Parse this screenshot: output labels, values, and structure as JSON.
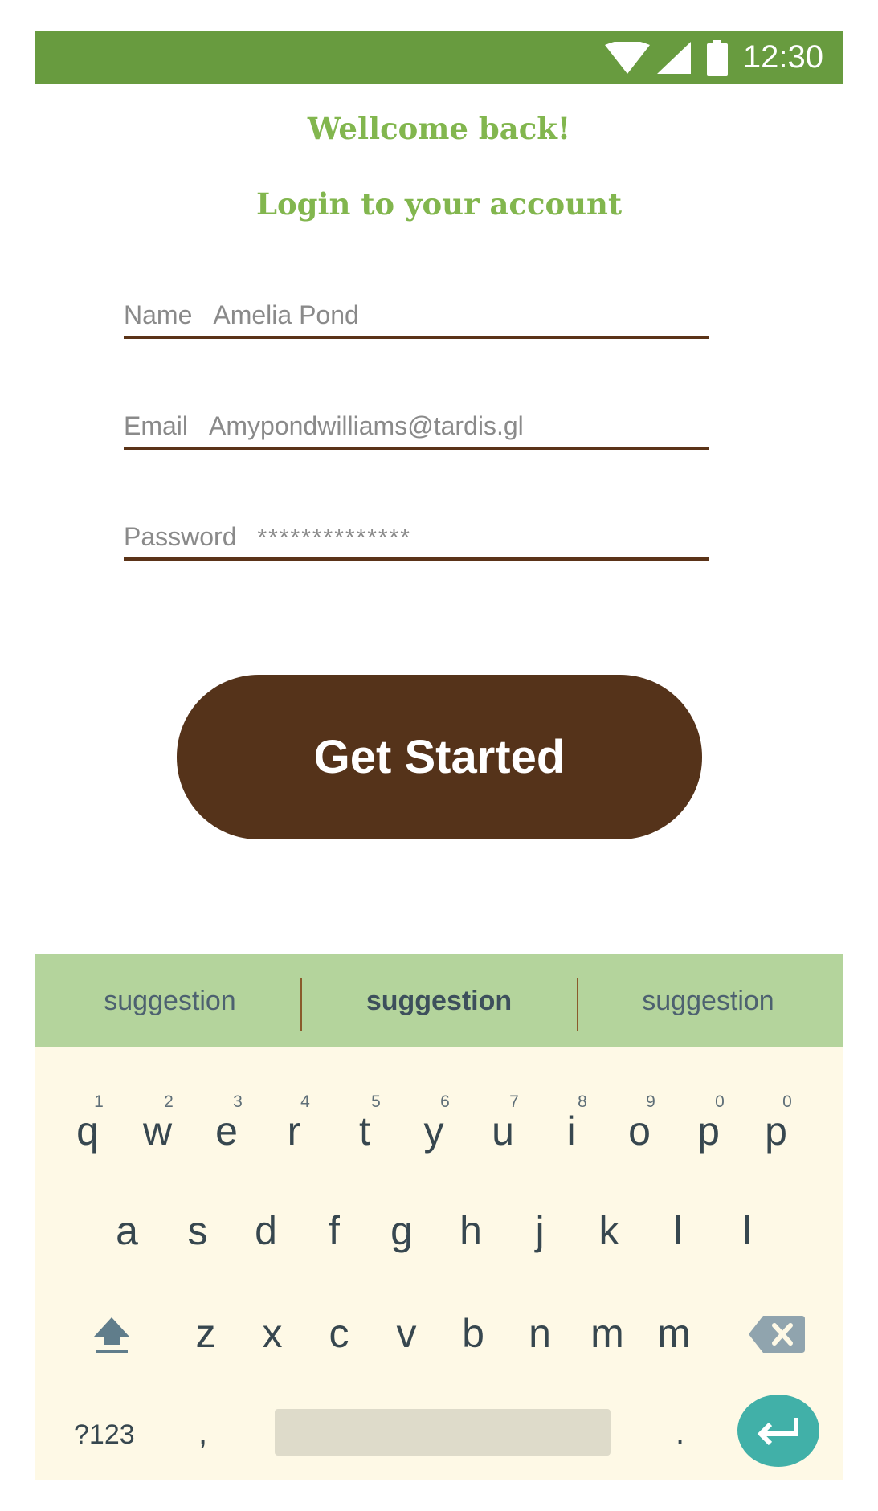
{
  "status_bar": {
    "time": "12:30",
    "icons": [
      "wifi-icon",
      "cell-signal-icon",
      "battery-icon"
    ]
  },
  "header": {
    "welcome": "Wellcome back!",
    "subtitle": "Login to your account"
  },
  "form": {
    "name": {
      "label": "Name",
      "value": "Amelia Pond"
    },
    "email": {
      "label": "Email",
      "value": "Amypondwilliams@tardis.gl"
    },
    "password": {
      "label": "Password",
      "value": "**************"
    },
    "submit_label": "Get Started"
  },
  "keyboard": {
    "suggestions": [
      "suggestion",
      "suggestion",
      "suggestion"
    ],
    "row1": [
      {
        "k": "q",
        "h": "1"
      },
      {
        "k": "w",
        "h": "2"
      },
      {
        "k": "e",
        "h": "3"
      },
      {
        "k": "r",
        "h": "4"
      },
      {
        "k": "t",
        "h": "5"
      },
      {
        "k": "y",
        "h": "6"
      },
      {
        "k": "u",
        "h": "7"
      },
      {
        "k": "i",
        "h": "8"
      },
      {
        "k": "o",
        "h": "9"
      },
      {
        "k": "p",
        "h": "0"
      },
      {
        "k": "p",
        "h": "0"
      }
    ],
    "row2": [
      "a",
      "s",
      "d",
      "f",
      "g",
      "h",
      "j",
      "k",
      "l",
      "l"
    ],
    "row3": [
      "z",
      "x",
      "c",
      "v",
      "b",
      "n",
      "m",
      "m"
    ],
    "symbols_label": "?123",
    "comma": ",",
    "period": ".",
    "icons": [
      "shift-icon",
      "backspace-icon",
      "enter-icon"
    ]
  },
  "colors": {
    "status_bar": "#689b3f",
    "heading": "#82b64e",
    "accent_brown": "#55331a",
    "suggestion_bar": "#b4d49c",
    "keyboard_bg": "#fef9e6",
    "enter_button": "#41b0a8"
  }
}
